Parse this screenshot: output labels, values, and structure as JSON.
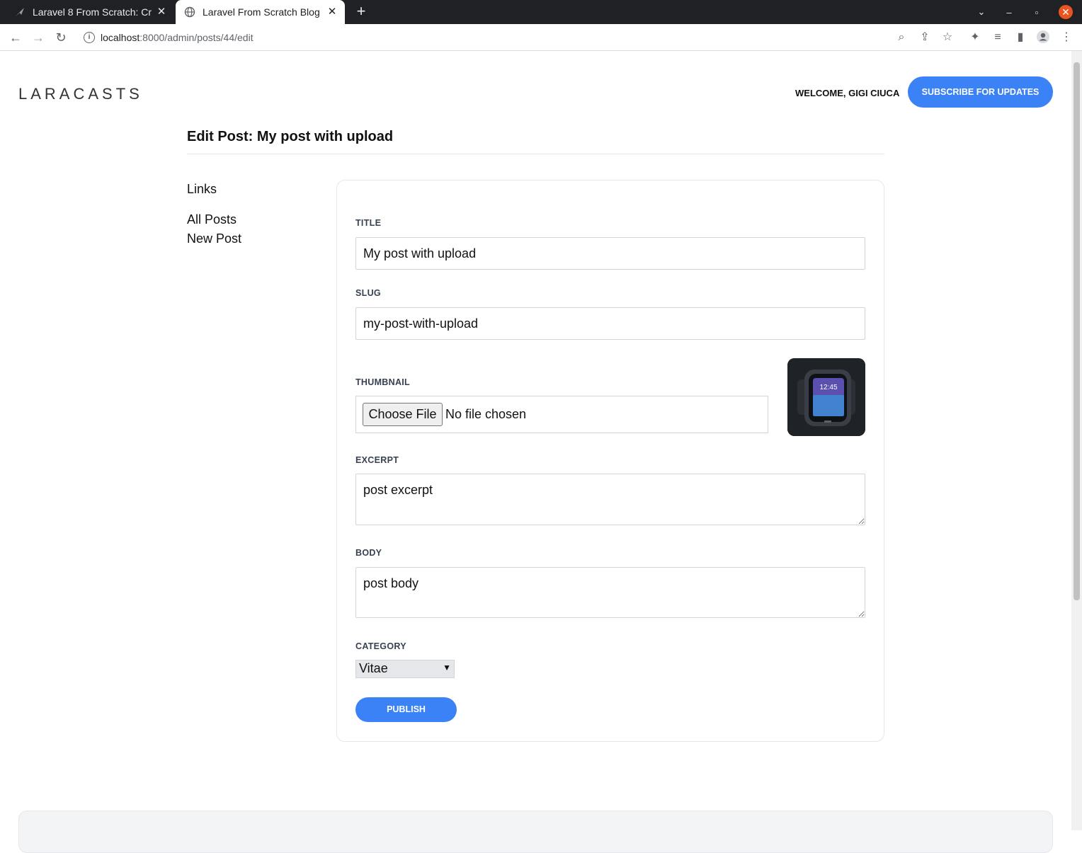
{
  "browser": {
    "tabs": [
      {
        "title": "Laravel 8 From Scratch: Cr",
        "active": false
      },
      {
        "title": "Laravel From Scratch Blog",
        "active": true
      }
    ],
    "url_host": "localhost",
    "url_path": ":8000/admin/posts/44/edit"
  },
  "header": {
    "logo": "LARACASTS",
    "welcome": "WELCOME, GIGI CIUCA",
    "subscribe_label": "SUBSCRIBE FOR UPDATES"
  },
  "page": {
    "title": "Edit Post: My post with upload"
  },
  "sidebar": {
    "heading": "Links",
    "items": [
      "All Posts",
      "New Post"
    ]
  },
  "form": {
    "title_label": "TITLE",
    "title_value": "My post with upload",
    "slug_label": "SLUG",
    "slug_value": "my-post-with-upload",
    "thumbnail_label": "THUMBNAIL",
    "file_button": "Choose File",
    "file_status": "No file chosen",
    "excerpt_label": "EXCERPT",
    "excerpt_value": "post excerpt",
    "body_label": "BODY",
    "body_value": "post body",
    "category_label": "CATEGORY",
    "category_value": "Vitae",
    "publish_label": "PUBLISH",
    "thumbnail_time": "12:45"
  },
  "colors": {
    "accent": "#3b82f6",
    "chrome_dark": "#202124",
    "close_button": "#e95420"
  }
}
